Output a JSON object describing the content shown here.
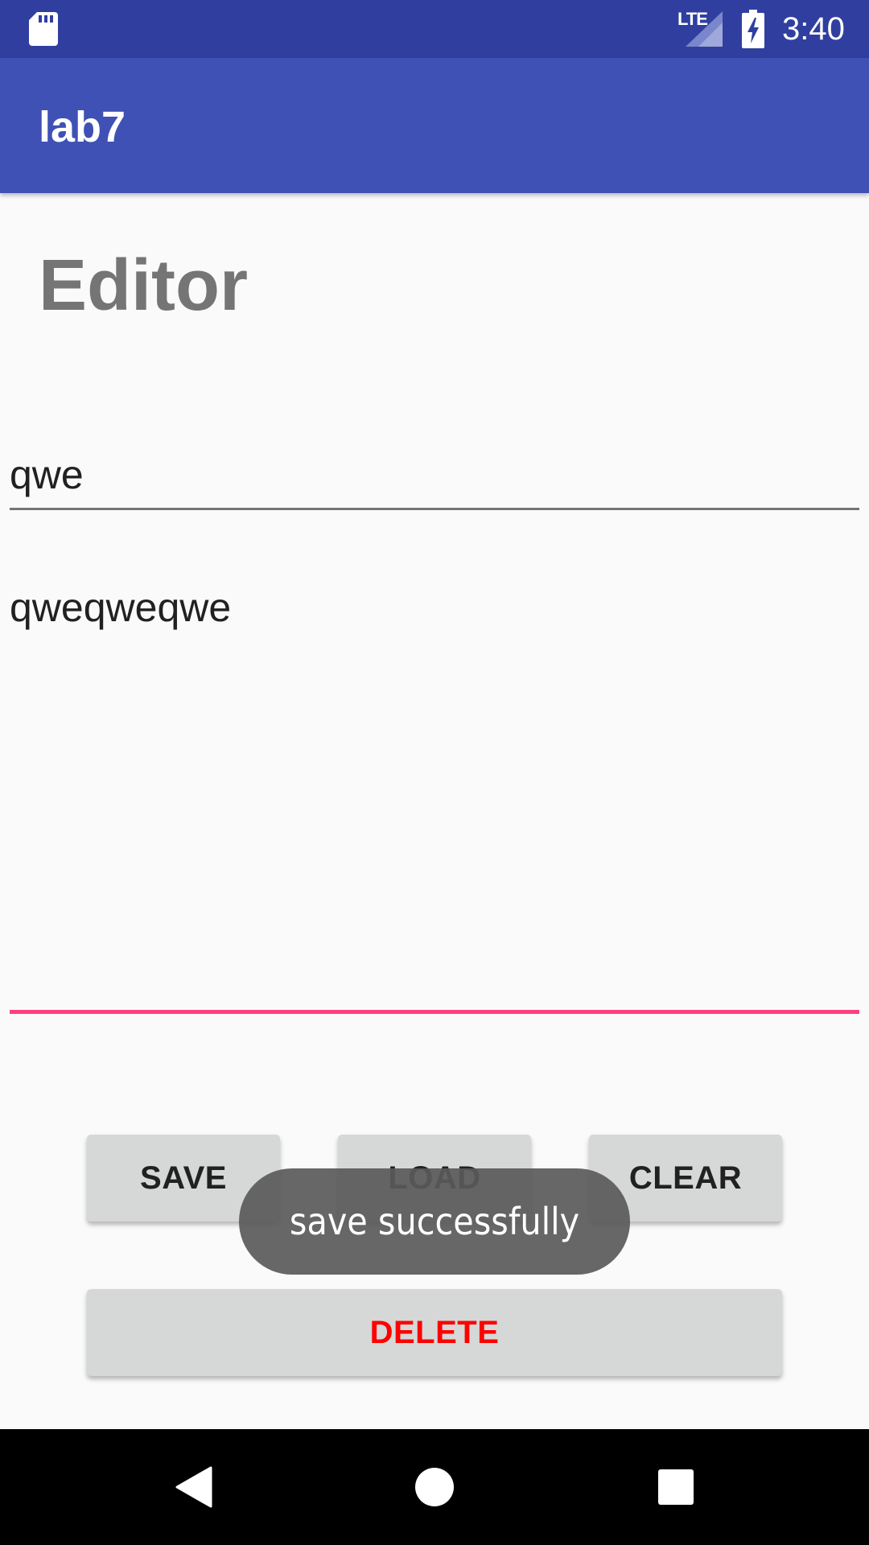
{
  "status_bar": {
    "time": "3:40",
    "network": "LTE",
    "icons": [
      "sd-card-icon",
      "signal-icon",
      "battery-charging-icon"
    ]
  },
  "app_bar": {
    "title": "lab7"
  },
  "main": {
    "heading": "Editor",
    "filename_value": "qwe",
    "content_value": "qweqweqwe"
  },
  "buttons": {
    "save": "SAVE",
    "load": "LOAD",
    "clear": "CLEAR",
    "delete": "DELETE"
  },
  "toast": {
    "message": "save successfully"
  },
  "nav_bar": {
    "icons": [
      "back-icon",
      "home-icon",
      "recents-icon"
    ]
  },
  "colors": {
    "status_bar": "#303f9f",
    "app_bar": "#3f51b5",
    "accent": "#ff4081",
    "delete_text": "#ff0000",
    "button_bg": "#d6d7d7"
  }
}
